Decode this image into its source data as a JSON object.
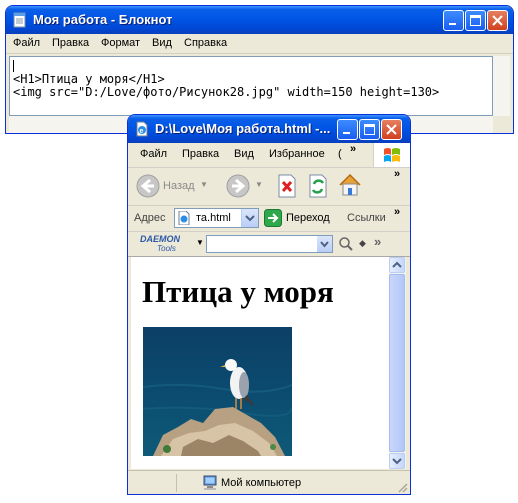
{
  "notepad": {
    "title": "Моя работа - Блокнот",
    "menu": [
      "Файл",
      "Правка",
      "Формат",
      "Вид",
      "Справка"
    ],
    "lines": [
      "<H1>Птица у моря</H1>",
      "<img src=\"D:/Love/фото/Рисунок28.jpg\" width=150 height=130>"
    ]
  },
  "ie": {
    "title": "D:\\Love\\Моя работа.html -...",
    "menu": [
      "Файл",
      "Правка",
      "Вид",
      "Избранное",
      "("
    ],
    "menu_more": "»",
    "toolbar": {
      "back_label": "Назад",
      "more": "»"
    },
    "address": {
      "label": "Адрес",
      "value": "та.html",
      "go_label": "Переход",
      "links_label": "Ссылки",
      "more": "»"
    },
    "daemon": {
      "logo_top": "DAEMON",
      "logo_bottom": "Tools",
      "more": "»"
    },
    "page": {
      "heading": "Птица у моря"
    },
    "status": {
      "zone": "Мой компьютер"
    }
  },
  "colors": {
    "titlebar": "#0055e5",
    "window_face": "#ece9d8",
    "close_button": "#d1401f"
  }
}
